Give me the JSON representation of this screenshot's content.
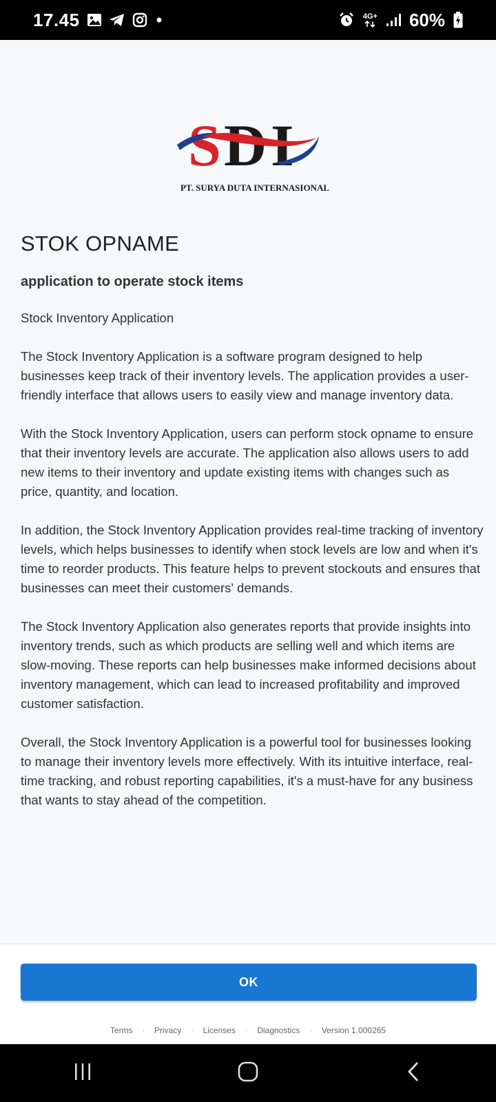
{
  "status_bar": {
    "time": "17.45",
    "network": "4G+",
    "battery": "60%",
    "icons": [
      "gallery-icon",
      "telegram-icon",
      "instagram-icon",
      "notification-dot-icon",
      "alarm-icon",
      "network-activity-icon",
      "signal-icon",
      "battery-icon"
    ]
  },
  "logo": {
    "mark": "SDI",
    "company": "PT. SURYA DUTA INTERNASIONAL",
    "colors": {
      "red": "#d8232a",
      "blue": "#1f3f8f",
      "dark": "#1a1a1a"
    }
  },
  "app": {
    "title": "STOK OPNAME",
    "subtitle": "application to operate stock items"
  },
  "description": {
    "heading": "Stock Inventory Application",
    "paragraphs": [
      "The Stock Inventory Application is a software program designed to help businesses keep track of their inventory levels. The application provides a user-friendly interface that allows users to easily view and manage inventory data.",
      "With the Stock Inventory Application, users can perform stock opname to ensure that their inventory levels are accurate. The application also allows users to add new items to their inventory and update existing items with changes such as price, quantity, and location.",
      "In addition, the Stock Inventory Application provides real-time tracking of inventory levels, which helps businesses to identify when stock levels are low and when it's time to reorder products. This feature helps to prevent stockouts and ensures that businesses can meet their customers' demands.",
      "The Stock Inventory Application also generates reports that provide insights into inventory trends, such as which products are selling well and which items are slow-moving. These reports can help businesses make informed decisions about inventory management, which can lead to increased profitability and improved customer satisfaction.",
      "Overall, the Stock Inventory Application is a powerful tool for businesses looking to manage their inventory levels more effectively. With its intuitive interface, real-time tracking, and robust reporting capabilities, it's a must-have for any business that wants to stay ahead of the competition."
    ]
  },
  "actions": {
    "ok_label": "OK",
    "accent": "#1976d2"
  },
  "footer": {
    "terms": "Terms",
    "privacy": "Privacy",
    "licenses": "Licenses",
    "diagnostics": "Diagnostics",
    "version": "Version 1.000265",
    "separator": "·"
  },
  "nav_bar": {
    "icons": [
      "recent-apps-icon",
      "home-icon",
      "back-icon"
    ]
  }
}
